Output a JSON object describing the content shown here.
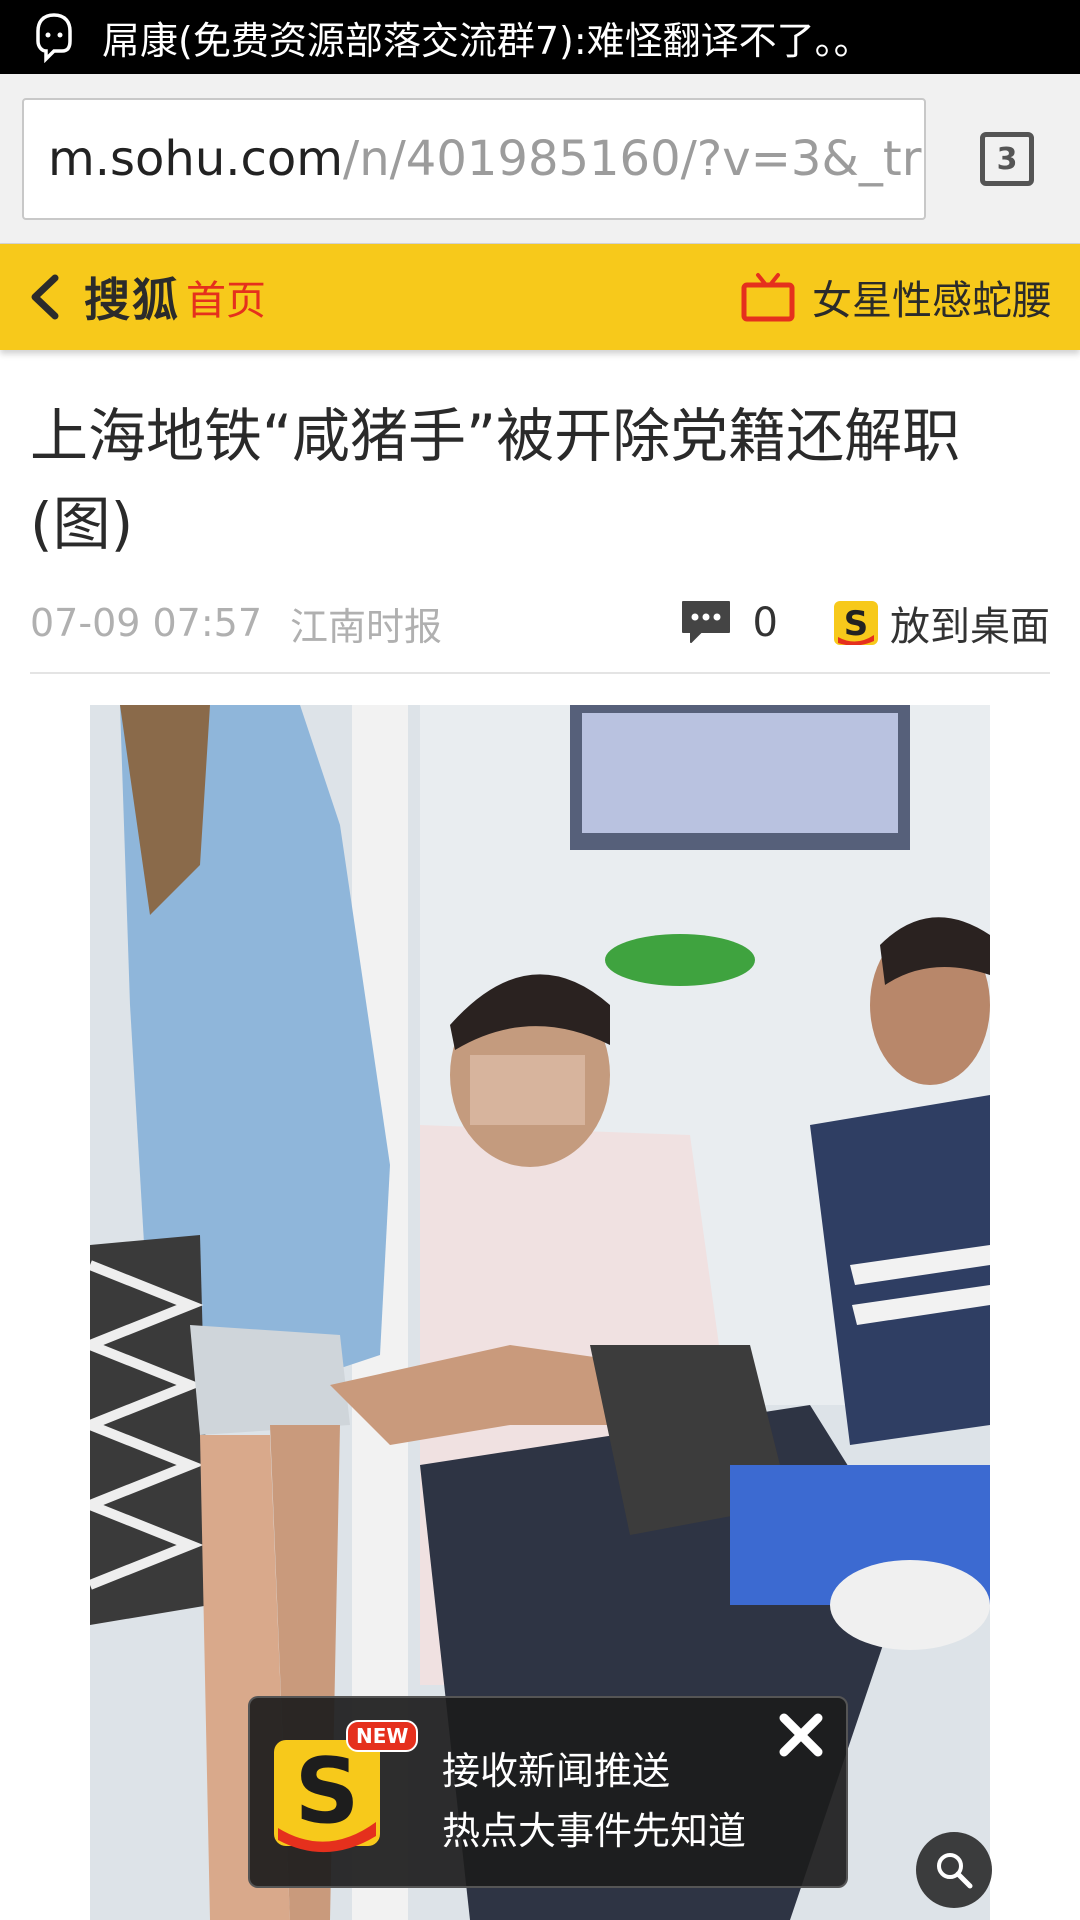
{
  "notification": {
    "icon": "chat-bubble-icon",
    "text": "屌康(免费资源部落交流群7):难怪翻译不了。。"
  },
  "browser": {
    "url_domain": "m.sohu.com",
    "url_path": "/n/401985160/?v=3&_tra",
    "tab_count": "3"
  },
  "header": {
    "back_icon": "chevron-left-icon",
    "logo": "搜狐",
    "home": "首页",
    "promo_icon": "tv-icon",
    "promo_text": "女星性感蛇腰"
  },
  "article": {
    "title": "上海地铁“咸猪手”被开除党籍还解职(图)",
    "time": "07-09 07:57",
    "source": "江南时报",
    "comment_count": "0",
    "desktop_label": "放到桌面"
  },
  "push_popup": {
    "badge": "NEW",
    "line1": "接收新闻推送",
    "line2": "热点大事件先知道",
    "close_icon": "close-icon"
  },
  "search_fab": {
    "icon": "search-icon"
  },
  "colors": {
    "header_yellow": "#f7c91b",
    "accent_red": "#e5301d"
  }
}
